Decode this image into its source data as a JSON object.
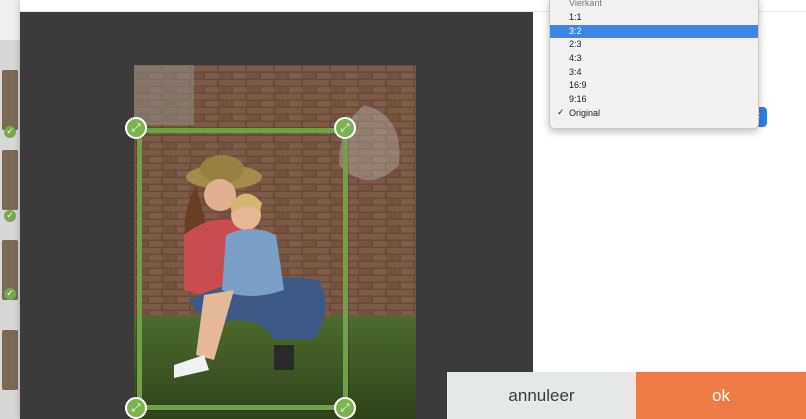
{
  "dropdown": {
    "partial_item": "Vierkant",
    "items": [
      {
        "label": "1:1",
        "selected": false,
        "checked": false
      },
      {
        "label": "3:2",
        "selected": true,
        "checked": false
      },
      {
        "label": "2:3",
        "selected": false,
        "checked": false
      },
      {
        "label": "4:3",
        "selected": false,
        "checked": false
      },
      {
        "label": "3:4",
        "selected": false,
        "checked": false
      },
      {
        "label": "16:9",
        "selected": false,
        "checked": false
      },
      {
        "label": "9:16",
        "selected": false,
        "checked": false
      },
      {
        "label": "Original",
        "selected": false,
        "checked": true
      }
    ],
    "check_glyph": "✓"
  },
  "buttons": {
    "cancel_label": "annuleer",
    "ok_label": "ok"
  },
  "icons": {
    "crop_handle": "resize-arrows-icon",
    "select_arrow": "chevron-updown-icon",
    "thumb_check": "check-icon"
  },
  "colors": {
    "editor_bg": "#3b3b3b",
    "crop_frame": "#6ea244",
    "selected_item": "#3b86e8",
    "ok_button": "#ee7a45",
    "cancel_button": "#e6e8e8"
  }
}
